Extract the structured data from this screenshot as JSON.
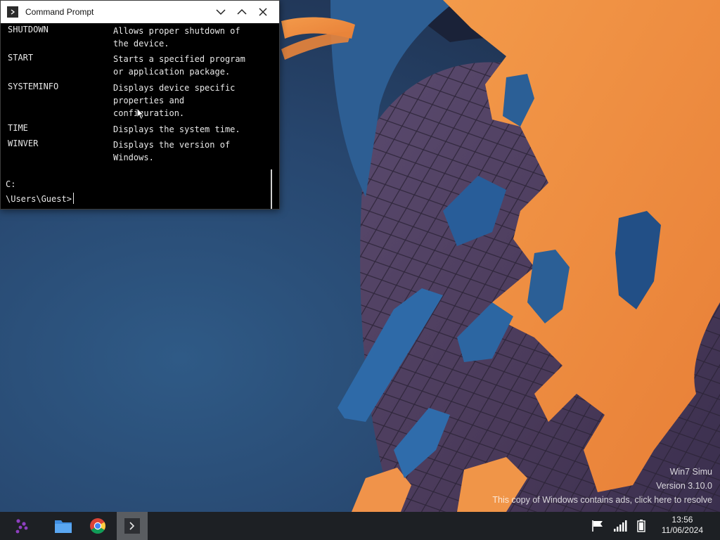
{
  "cmd_window": {
    "title": "Command Prompt",
    "help_entries": [
      {
        "command": "SHUTDOWN",
        "description": "Allows proper shutdown of\nthe device."
      },
      {
        "command": "START",
        "description": "Starts a specified program\nor application package."
      },
      {
        "command": "SYSTEMINFO",
        "description": "Displays device specific\nproperties and\nconfiguration."
      },
      {
        "command": "TIME",
        "description": "Displays the system time."
      },
      {
        "command": "WINVER",
        "description": "Displays the version of\nWindows."
      }
    ],
    "prompt_line1": "C:",
    "prompt_line2": "\\Users\\Guest>"
  },
  "watermark": {
    "line1": "Win7 Simu",
    "line2": "Version 3.10.0",
    "line3": "This copy of Windows contains ads, click here to resolve"
  },
  "taskbar": {
    "start_icon": "start-menu-icon",
    "pinned": [
      {
        "name": "file-explorer-icon"
      },
      {
        "name": "chrome-icon"
      },
      {
        "name": "command-prompt-icon",
        "active": true
      }
    ],
    "tray": [
      "flag-icon",
      "signal-icon",
      "battery-icon"
    ],
    "clock_time": "13:56",
    "clock_date": "11/06/2024"
  },
  "colors": {
    "wallpaper_blue": "#253f63",
    "wallpaper_orange": "#ef8a3f",
    "taskbar": "#1d2024",
    "terminal_bg": "#000000",
    "terminal_fg": "#e8e8e8",
    "start_accent": "#8e3fc0"
  }
}
